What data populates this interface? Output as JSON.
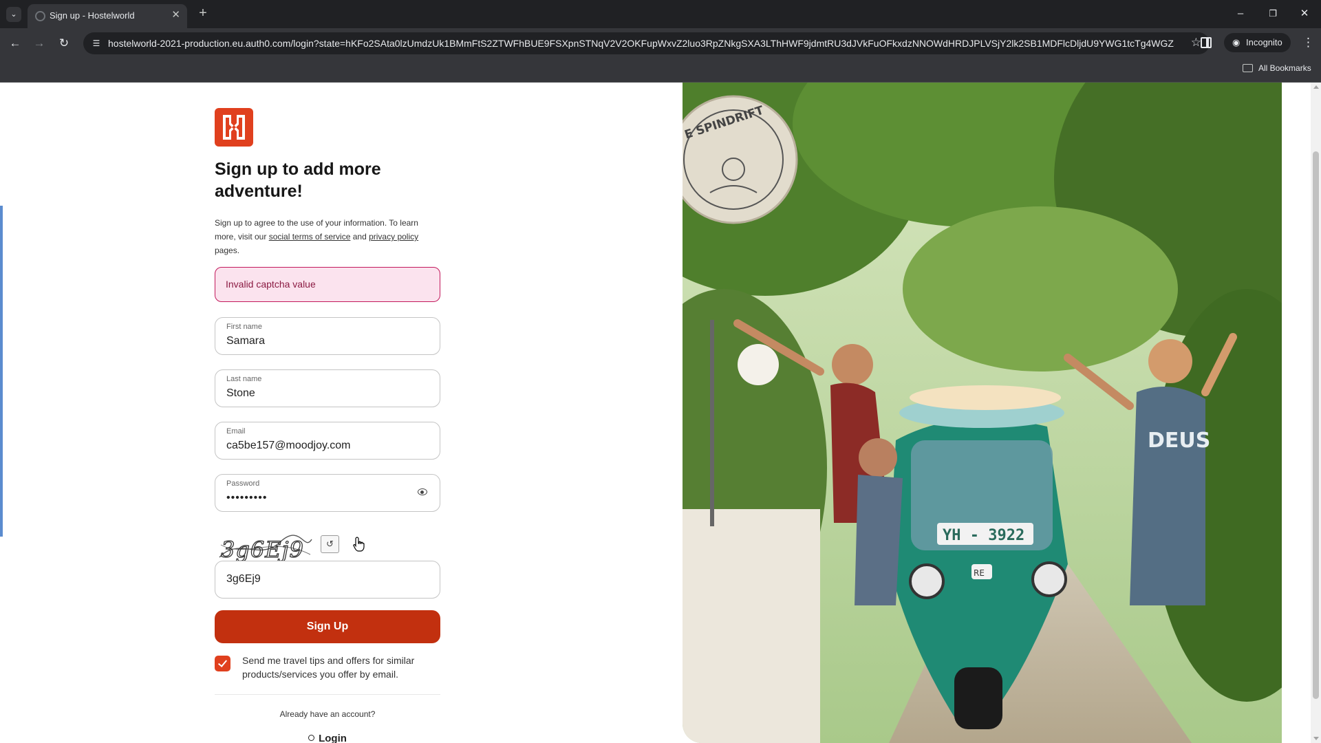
{
  "browser": {
    "tab_title": "Sign up - Hostelworld",
    "url": "hostelworld-2021-production.eu.auth0.com/login?state=hKFo2SAta0lzUmdzUk1BMmFtS2ZTWFhBUE9FSXpnSTNqV2V2OKFupWxvZ2luo3RpZNkgSXA3LThHWF9jdmtRU3dJVkFuOFkxdzNNOWdHRDJPLVSjY2lk2SB1MDFlcDljdU9YWG1tcTg4WGZSRFZ...",
    "incognito_label": "Incognito",
    "all_bookmarks_label": "All Bookmarks"
  },
  "signup": {
    "heading": "Sign up to add more adventure!",
    "legal_prefix": "Sign up to agree to the use of your information. To learn more, visit our ",
    "social_terms_link": "social terms of service",
    "legal_middle": " and ",
    "privacy_link": "privacy policy",
    "legal_suffix": " pages.",
    "error_message": "Invalid captcha value",
    "first_name": {
      "label": "First name",
      "value": "Samara"
    },
    "last_name": {
      "label": "Last name",
      "value": "Stone"
    },
    "email": {
      "label": "Email",
      "value": "ca5be157@moodjoy.com"
    },
    "password": {
      "label": "Password",
      "masked_value": "•••••••••"
    },
    "captcha_image_text": "3g6Ej9",
    "captcha_input_value": "3g6Ej9",
    "submit_label": "Sign Up",
    "marketing_opt_in": {
      "checked": true,
      "label": "Send me travel tips and offers for similar products/services you offer by email."
    },
    "already_account": "Already have an account?",
    "login_label": "Login"
  },
  "hero": {
    "sign_text": "E SPINDRIFT",
    "plate_text": "YH - 3922",
    "shirt_text": "DEUS",
    "badge_text": "RE"
  },
  "colors": {
    "brand_orange": "#e0401e",
    "button_red": "#c2300f",
    "error_bg": "#fbe3ee",
    "error_border": "#c2185b"
  }
}
